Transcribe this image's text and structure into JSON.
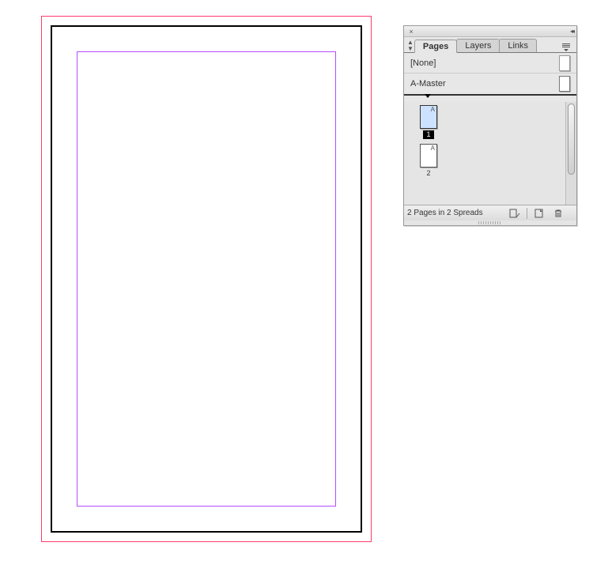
{
  "canvas": {
    "bleed_color": "#ff3b6b",
    "margin_color": "#b64bff"
  },
  "panel": {
    "tabs": {
      "pages": "Pages",
      "layers": "Layers",
      "links": "Links"
    },
    "masters": {
      "none_label": "[None]",
      "amaster_label": "A-Master"
    },
    "pages": {
      "p1": {
        "master_prefix": "A",
        "number": "1"
      },
      "p2": {
        "master_prefix": "A",
        "number": "2"
      }
    },
    "status_text": "2 Pages in 2 Spreads",
    "icons": {
      "close": "×",
      "collapse": "◂◂"
    }
  }
}
